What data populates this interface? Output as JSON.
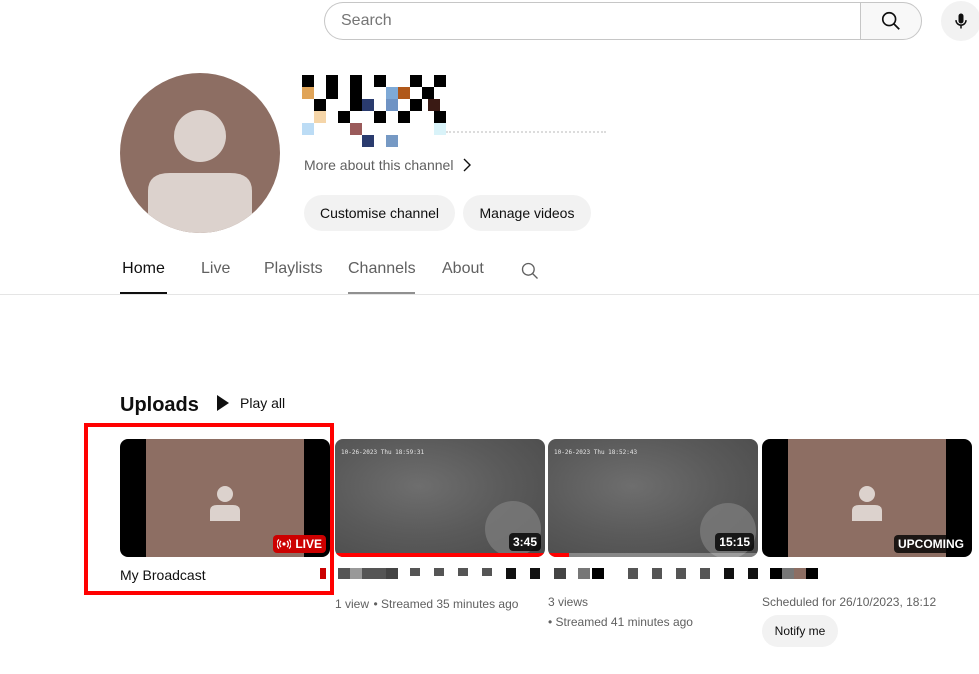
{
  "search": {
    "placeholder": "Search"
  },
  "icons": {
    "search": "search-icon",
    "mic": "mic-icon",
    "chevron": "chevron-right-icon",
    "play": "play-icon",
    "live": "live-broadcast-icon",
    "tab_search": "search-icon"
  },
  "colors": {
    "avatar": "#8d6e63",
    "live_red": "#cc0000",
    "highlight": "#ff0000"
  },
  "channel": {
    "more_about": "More about this channel",
    "customise": "Customise channel",
    "manage": "Manage videos"
  },
  "tabs": [
    {
      "label": "Home",
      "active": true
    },
    {
      "label": "Live",
      "active": false
    },
    {
      "label": "Playlists",
      "active": false
    },
    {
      "label": "Channels",
      "active": false,
      "hover": true
    },
    {
      "label": "About",
      "active": false
    }
  ],
  "uploads": {
    "title": "Uploads",
    "play_all": "Play all",
    "videos": [
      {
        "title": "My Broadcast",
        "badge": "LIVE"
      },
      {
        "timestamp": "10-26-2023 Thu 18:59:31",
        "duration": "3:45",
        "views": "1 view",
        "time": "Streamed 35 minutes ago",
        "watched": 1.0
      },
      {
        "timestamp": "10-26-2023 Thu 18:52:43",
        "duration": "15:15",
        "views": "3 views",
        "time": "Streamed 41 minutes ago",
        "watched": 0.1
      },
      {
        "badge": "UPCOMING",
        "scheduled": "Scheduled for 26/10/2023, 18:12",
        "notify": "Notify me"
      }
    ]
  }
}
